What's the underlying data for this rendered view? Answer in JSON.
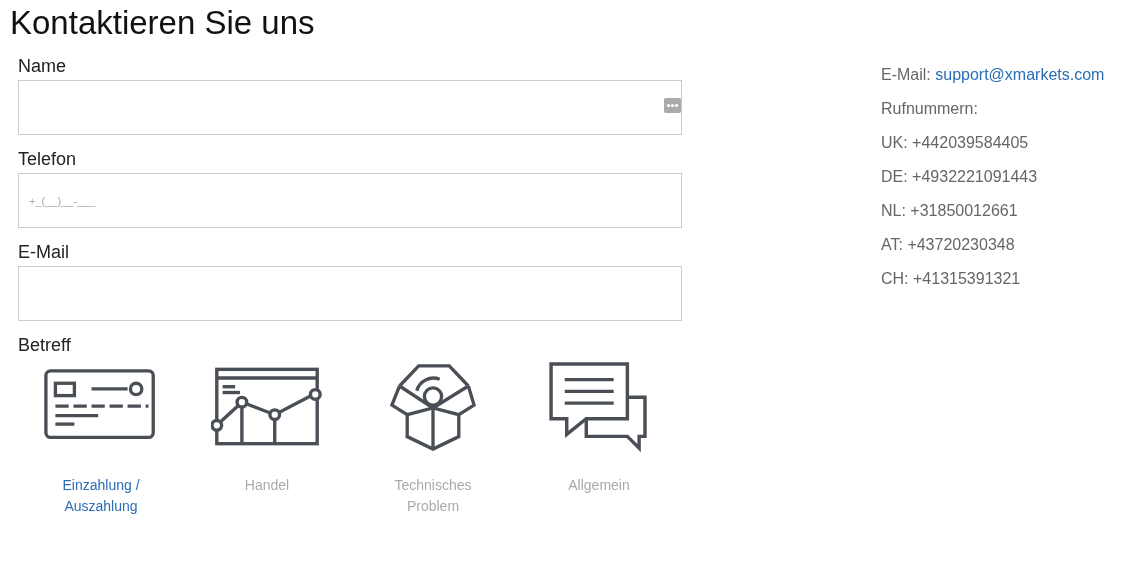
{
  "title": "Kontaktieren Sie uns",
  "fields": [
    {
      "label": "Name",
      "menu_icon": true
    },
    {
      "label": "Telefon",
      "placeholder": "+_(__)__-___",
      "menu_icon": false
    },
    {
      "label": "E-Mail",
      "menu_icon": false
    }
  ],
  "subject": {
    "label": "Betreff",
    "options": [
      {
        "kind": "card",
        "label": "Einzahlung / Auszahlung",
        "selected": true
      },
      {
        "kind": "chart",
        "label": "Handel",
        "selected": false
      },
      {
        "kind": "box",
        "label": "Technisches Problem",
        "selected": false
      },
      {
        "kind": "chat",
        "label": "Allgemein",
        "selected": false
      }
    ]
  },
  "contact": {
    "email_label": "E-Mail:",
    "email": "support@xmarkets.com",
    "phones_label": "Rufnummern:",
    "phones": [
      "UK: +442039584405",
      "DE: +4932221091443",
      "NL: +31850012661",
      "AT: +43720230348",
      "CH: +41315391321"
    ]
  }
}
